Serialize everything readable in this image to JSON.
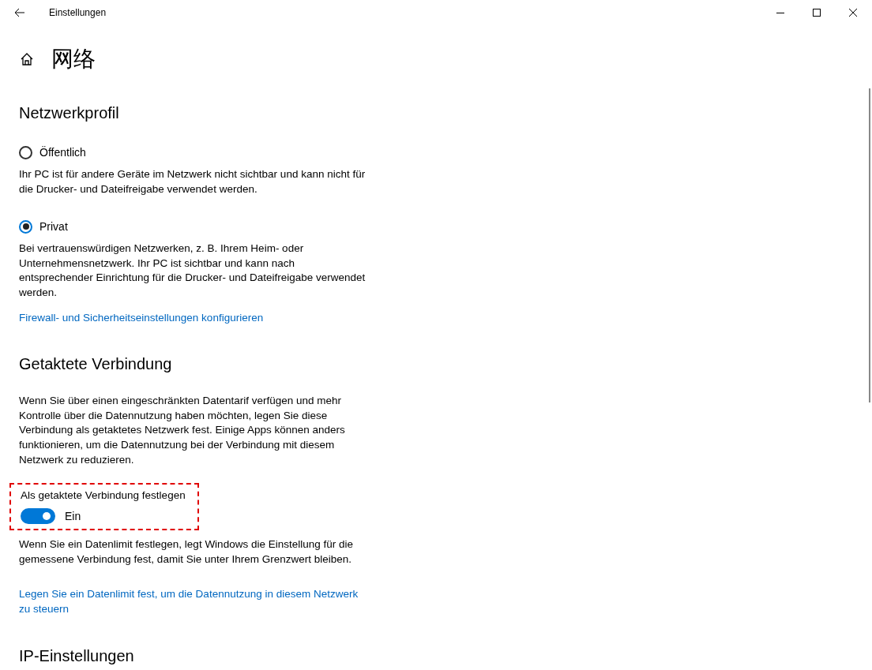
{
  "window": {
    "title": "Einstellungen"
  },
  "page_title": "网络",
  "sections": [
    {
      "heading": "Netzwerkprofil",
      "items": [
        {
          "kind": "radio",
          "label": "Öffentlich",
          "selected": false
        },
        {
          "kind": "text",
          "text": "Ihr PC ist für andere Geräte im Netzwerk nicht sichtbar und kann nicht für die Drucker- und Dateifreigabe verwendet werden."
        },
        {
          "kind": "radio",
          "label": "Privat",
          "selected": true
        },
        {
          "kind": "text",
          "text": "Bei vertrauenswürdigen Netzwerken, z. B. Ihrem Heim- oder Unternehmensnetzwerk. Ihr PC ist sichtbar und kann nach entsprechender Einrichtung für die Drucker- und Dateifreigabe verwendet werden."
        },
        {
          "kind": "link",
          "text": "Firewall- und Sicherheitseinstellungen konfigurieren"
        }
      ]
    },
    {
      "heading": "Getaktete Verbindung",
      "items": [
        {
          "kind": "text",
          "text": "Wenn Sie über einen eingeschränkten Datentarif verfügen und mehr Kontrolle über die Datennutzung haben möchten, legen Sie diese Verbindung als getaktetes Netzwerk fest. Einige Apps können anders funktionieren, um die Datennutzung bei der Verbindung mit diesem Netzwerk zu reduzieren."
        },
        {
          "kind": "toggle",
          "label": "Als getaktete Verbindung festlegen",
          "on": true,
          "state_text": "Ein",
          "highlighted": true
        },
        {
          "kind": "text",
          "text": "Wenn Sie ein Datenlimit festlegen, legt Windows die Einstellung für die gemessene Verbindung fest, damit Sie unter Ihrem Grenzwert bleiben."
        },
        {
          "kind": "link",
          "text": "Legen Sie ein Datenlimit fest, um die Datennutzung in diesem Netzwerk zu steuern"
        }
      ]
    },
    {
      "heading": "IP-Einstellungen"
    }
  ]
}
